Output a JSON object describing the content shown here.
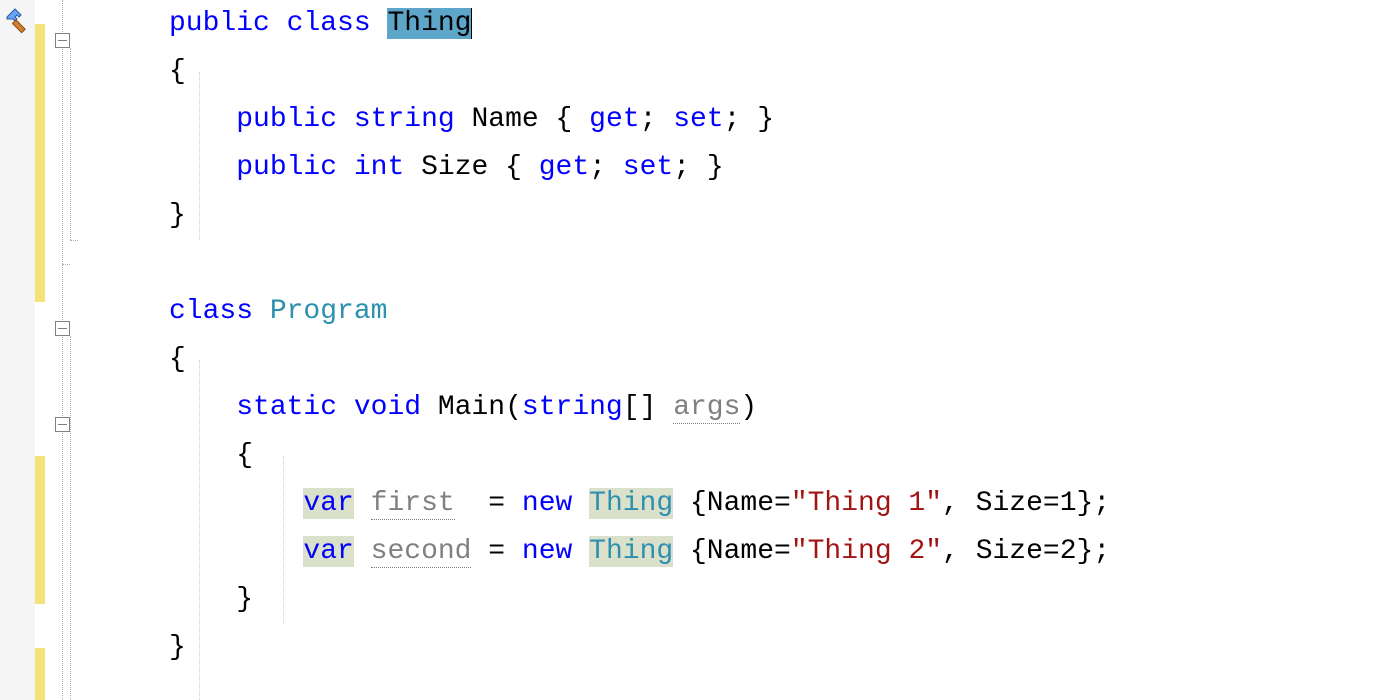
{
  "tokens": {
    "kw_public": "public",
    "kw_class": "class",
    "kw_string": "string",
    "kw_int": "int",
    "kw_get": "get",
    "kw_set": "set",
    "kw_static": "static",
    "kw_void": "void",
    "kw_var": "var",
    "kw_new": "new",
    "type_Thing": "Thing",
    "type_Program": "Program",
    "id_Name": "Name",
    "id_Size": "Size",
    "id_Main": "Main",
    "id_args": "args",
    "id_first": "first",
    "id_second": "second",
    "str_thing1": "\"Thing 1\"",
    "str_thing2": "\"Thing 2\"",
    "num_1": "1",
    "num_2": "2"
  },
  "punct": {
    "lbrace": "{",
    "rbrace": "}",
    "lparen": "(",
    "rparen": ")",
    "lbracket": "[",
    "rbracket": "]",
    "semi": ";",
    "comma": ",",
    "eq": "=",
    "sp": " "
  }
}
